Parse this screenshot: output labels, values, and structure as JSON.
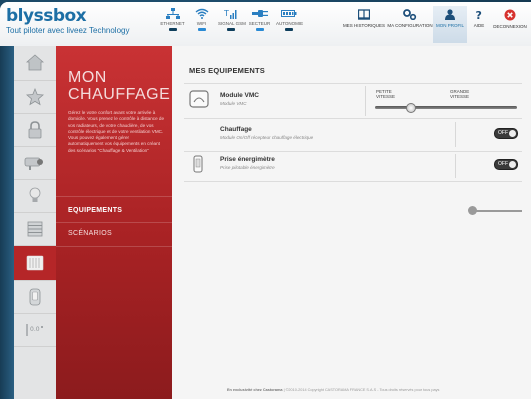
{
  "app": {
    "brand": "blyssbox",
    "tagline": "Tout piloter avec liveez Technology"
  },
  "status": [
    {
      "label": "ETHERNET",
      "icon": "ethernet-icon",
      "on": false
    },
    {
      "label": "WIFI",
      "icon": "wifi-icon",
      "on": true
    },
    {
      "label": "SIGNAL GSM",
      "icon": "gsm-signal-icon",
      "on": false
    },
    {
      "label": "SECTEUR",
      "icon": "power-plug-icon",
      "on": true
    },
    {
      "label": "AUTONOMIE",
      "icon": "battery-icon",
      "on": false
    }
  ],
  "nav": [
    {
      "label": "MES HISTORIQUES",
      "icon": "book-icon",
      "active": false
    },
    {
      "label": "MA CONFIGURATION",
      "icon": "config-icon",
      "active": false
    },
    {
      "label": "MON PROFIL",
      "icon": "user-icon",
      "active": true
    },
    {
      "label": "AIDE",
      "icon": "help-icon",
      "active": false
    },
    {
      "label": "DECONNEXION",
      "icon": "logout-icon",
      "active": false
    }
  ],
  "sidebar": [
    {
      "icon": "house-icon",
      "active": false
    },
    {
      "icon": "star-icon",
      "active": false
    },
    {
      "icon": "lock-icon",
      "active": false
    },
    {
      "icon": "camera-icon",
      "active": false
    },
    {
      "icon": "bulb-icon",
      "active": false
    },
    {
      "icon": "shutter-icon",
      "active": false
    },
    {
      "icon": "heater-icon",
      "active": true
    },
    {
      "icon": "plug-icon",
      "active": false
    },
    {
      "icon": "sensor-icon",
      "active": false
    }
  ],
  "panel": {
    "title_line1": "MON",
    "title_line2": "CHAUFFAGE",
    "description": "Gérez le votre confort avant votre arrivée à domicile. Vous prenez le contrôle à distance de vos radiateurs, de votre chaudière, de vos contrôle électrique et de votre ventilation VMC. Vous pouvez également gérer automatiquement vos équipements en créant des scénarios \"Chauffage & Ventilation\"",
    "menu": [
      {
        "label": "EQUIPEMENTS",
        "active": true
      },
      {
        "label": "SCÉNARIOS",
        "active": false
      }
    ]
  },
  "main": {
    "heading": "MES EQUIPEMENTS",
    "vmc": {
      "title": "Module VMC",
      "subtitle": "Module VMC",
      "speed_low": "PETITE VITESSE",
      "speed_high": "GRANDE VITESSE",
      "speed_value": 0.25
    },
    "chauffage": {
      "title": "Chauffage",
      "subtitle": "Module On/Off récepteur chauffage électrique",
      "toggle": "OFF"
    },
    "prise": {
      "title": "Prise énergimètre",
      "subtitle": "Prise pilotable énergimètre",
      "toggle": "OFF"
    }
  },
  "footer": {
    "left": "En exclusivité chez Castorama",
    "right": "©2010-2014 Copyright CASTORAMA FRANCE S.A.S - Tous droits réservés pour tous pays"
  }
}
